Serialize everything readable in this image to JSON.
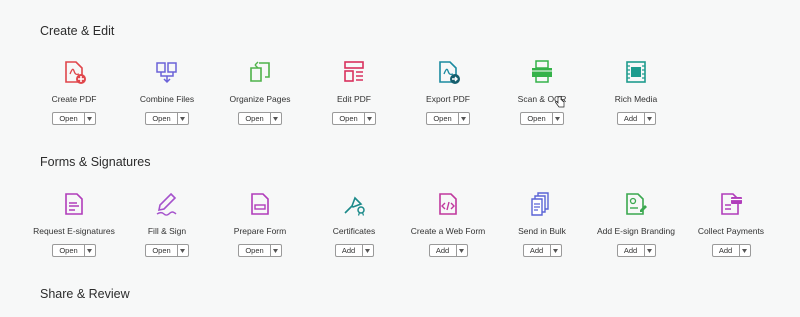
{
  "sections": [
    {
      "title": "Create & Edit",
      "tools": [
        {
          "label": "Create PDF",
          "action": "Open",
          "icon": "create-pdf-icon",
          "color": "#e0464b"
        },
        {
          "label": "Combine Files",
          "action": "Open",
          "icon": "combine-files-icon",
          "color": "#6b62d8"
        },
        {
          "label": "Organize Pages",
          "action": "Open",
          "icon": "organize-pages-icon",
          "color": "#4fb34a"
        },
        {
          "label": "Edit PDF",
          "action": "Open",
          "icon": "edit-pdf-icon",
          "color": "#d9315d"
        },
        {
          "label": "Export PDF",
          "action": "Open",
          "icon": "export-pdf-icon",
          "color": "#1a8aa0"
        },
        {
          "label": "Scan & OCR",
          "action": "Open",
          "icon": "scan-ocr-icon",
          "color": "#35b24a"
        },
        {
          "label": "Rich Media",
          "action": "Add",
          "icon": "rich-media-icon",
          "color": "#1e9c8e"
        }
      ]
    },
    {
      "title": "Forms & Signatures",
      "tools": [
        {
          "label": "Request E-signatures",
          "action": "Open",
          "icon": "request-esignatures-icon",
          "color": "#b13dbb"
        },
        {
          "label": "Fill & Sign",
          "action": "Open",
          "icon": "fill-sign-icon",
          "color": "#a552cc"
        },
        {
          "label": "Prepare Form",
          "action": "Open",
          "icon": "prepare-form-icon",
          "color": "#b13dbb"
        },
        {
          "label": "Certificates",
          "action": "Add",
          "icon": "certificates-icon",
          "color": "#1b8a8a"
        },
        {
          "label": "Create a Web Form",
          "action": "Add",
          "icon": "web-form-icon",
          "color": "#c0399e"
        },
        {
          "label": "Send in Bulk",
          "action": "Add",
          "icon": "send-in-bulk-icon",
          "color": "#5a63d6"
        },
        {
          "label": "Add E-sign Branding",
          "action": "Add",
          "icon": "esign-branding-icon",
          "color": "#3aa84f"
        },
        {
          "label": "Collect Payments",
          "action": "Add",
          "icon": "collect-payments-icon",
          "color": "#b13dbb"
        }
      ]
    },
    {
      "title": "Share & Review",
      "tools": []
    }
  ]
}
